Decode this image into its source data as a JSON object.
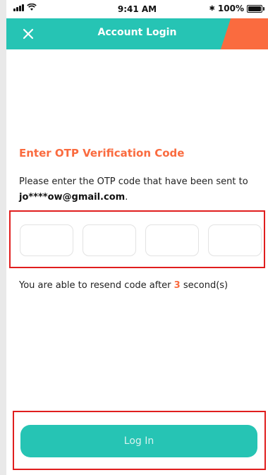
{
  "status_bar": {
    "time": "9:41 AM",
    "battery": "100%",
    "bluetooth_symbol": "✱"
  },
  "header": {
    "title": "Account Login",
    "close_icon": "close-icon",
    "accent_color": "#fa6b3f",
    "background_color": "#26c4b4"
  },
  "otp": {
    "title": "Enter OTP Verification Code",
    "description_prefix": "Please enter the OTP code that have been sent to ",
    "email": "jo****ow@gmail.com",
    "description_suffix": ".",
    "boxes": [
      {
        "value": ""
      },
      {
        "value": ""
      },
      {
        "value": ""
      },
      {
        "value": ""
      }
    ]
  },
  "resend": {
    "prefix": "You are able to resend code after ",
    "countdown": "3",
    "suffix": " second(s)"
  },
  "login": {
    "label": "Log In"
  }
}
